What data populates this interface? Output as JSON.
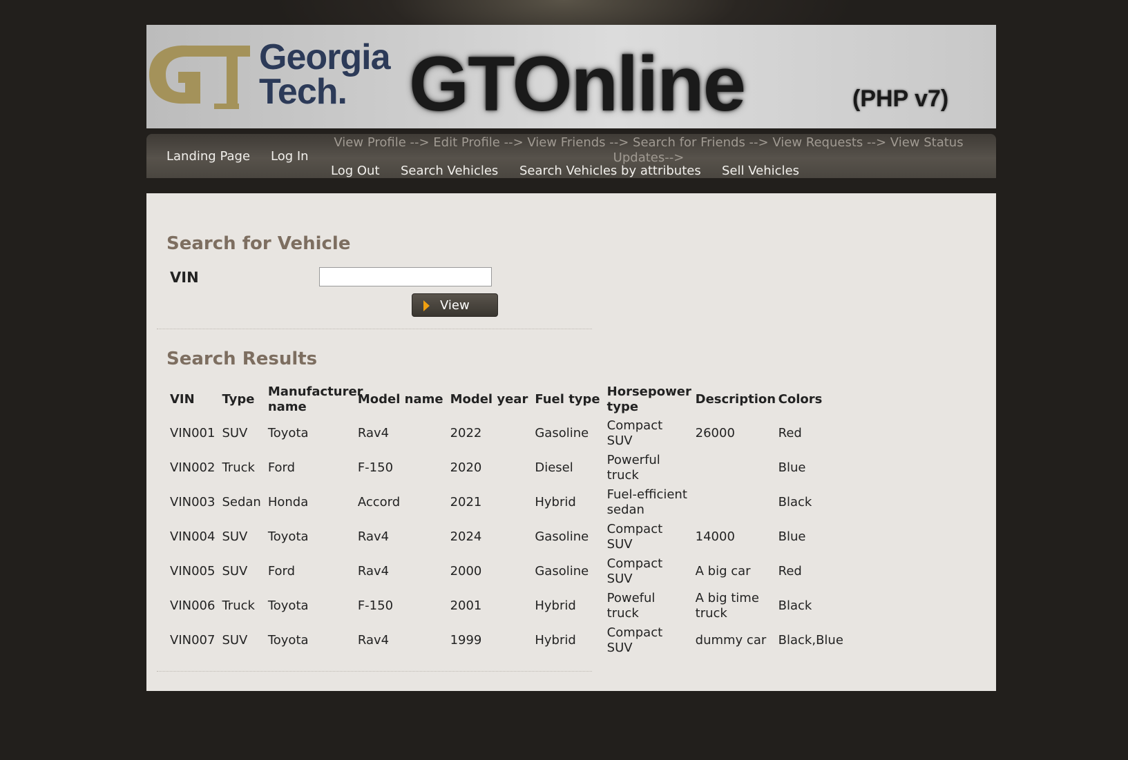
{
  "header": {
    "logo_mark": "GT",
    "logo_wordmark_line1": "Georgia",
    "logo_wordmark_line2": "Tech.",
    "app_title": "GTOnline",
    "version": "(PHP v7)"
  },
  "nav": {
    "landing_page": "Landing Page",
    "log_in": "Log In",
    "flow_text": "View Profile --> Edit Profile --> View Friends --> Search for Friends --> View Requests --> View Status Updates-->",
    "log_out": "Log Out",
    "search_vehicles": "Search Vehicles",
    "search_by_attributes": "Search Vehicles by attributes",
    "sell_vehicles": "Sell Vehicles"
  },
  "search": {
    "title": "Search for Vehicle",
    "vin_label": "VIN",
    "vin_value": "",
    "view_button": "View"
  },
  "results": {
    "title": "Search Results",
    "columns": [
      "VIN",
      "Type",
      "Manufacturer name",
      "Model name",
      "Model year",
      "Fuel type",
      "Horsepower type",
      "Description",
      "Colors"
    ],
    "rows": [
      [
        "VIN001",
        "SUV",
        "Toyota",
        "Rav4",
        "2022",
        "Gasoline",
        "Compact SUV",
        "26000",
        "Red"
      ],
      [
        "VIN002",
        "Truck",
        "Ford",
        "F-150",
        "2020",
        "Diesel",
        "Powerful truck",
        "",
        "Blue"
      ],
      [
        "VIN003",
        "Sedan",
        "Honda",
        "Accord",
        "2021",
        "Hybrid",
        "Fuel-efficient sedan",
        "",
        "Black"
      ],
      [
        "VIN004",
        "SUV",
        "Toyota",
        "Rav4",
        "2024",
        "Gasoline",
        "Compact SUV",
        "14000",
        "Blue"
      ],
      [
        "VIN005",
        "SUV",
        "Ford",
        "Rav4",
        "2000",
        "Gasoline",
        "Compact SUV",
        "A big car",
        "Red"
      ],
      [
        "VIN006",
        "Truck",
        "Toyota",
        "F-150",
        "2001",
        "Hybrid",
        "Poweful truck",
        "A big time truck",
        "Black"
      ],
      [
        "VIN007",
        "SUV",
        "Toyota",
        "Rav4",
        "1999",
        "Hybrid",
        "Compact SUV",
        "dummy car",
        "Black,Blue"
      ]
    ]
  },
  "colors": {
    "page_bg": "#221f1c",
    "panel_bg": "#e8e5e1",
    "section_title": "#7d6e60",
    "gt_gold": "#a4925a",
    "gt_navy": "#2c3a58",
    "button_arrow": "#f0a010"
  }
}
